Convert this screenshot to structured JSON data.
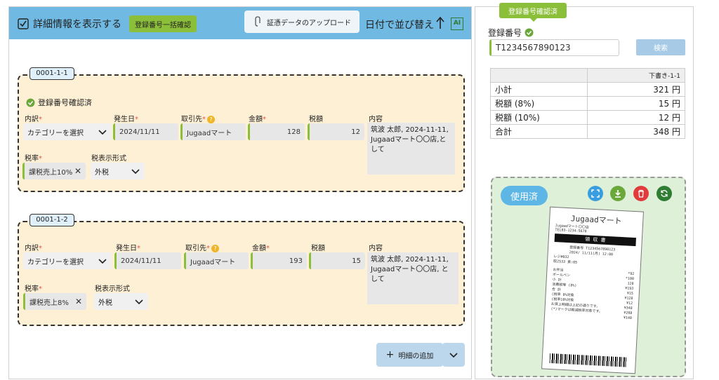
{
  "topbar": {
    "show_details": "詳細情報を表示する",
    "bulk_check": "登録番号一括確認",
    "upload": "証憑データのアップロード",
    "sort": "日付で並び替え"
  },
  "entries": [
    {
      "id": "0001-1-1",
      "status": "登録番号確認済",
      "category_label": "内訳",
      "category": "カテゴリーを選択",
      "date_label": "発生日",
      "date": "2024/11/11",
      "partner_label": "取引先",
      "partner": "Jugaadマート",
      "amount_label": "金額",
      "amount": "128",
      "tax_label": "税額",
      "tax": "12",
      "content_label": "内容",
      "content": "筑波 太郎, 2024-11-11, Jugaadマート〇〇店,として",
      "rate_label": "税率",
      "rate": "課税売上10%",
      "tax_display_label": "税表示形式",
      "tax_display": "外税"
    },
    {
      "id": "0001-1-2",
      "category_label": "内訳",
      "category": "カテゴリーを選択",
      "date_label": "発生日",
      "date": "2024/11/11",
      "partner_label": "取引先",
      "partner": "Jugaadマート",
      "amount_label": "金額",
      "amount": "193",
      "tax_label": "税額",
      "tax": "15",
      "content_label": "内容",
      "content": "筑波 太郎, 2024-11-11, Jugaadマート〇〇店, として",
      "rate_label": "税率",
      "rate": "課税売上8%",
      "tax_display_label": "税表示形式",
      "tax_display": "外税"
    }
  ],
  "add_detail": "明細の追加",
  "right": {
    "badge": "登録番号確認済",
    "reg_label": "登録番号",
    "reg_value": "T1234567890123",
    "search": "検索",
    "summary_header": "下書き-1-1",
    "rows": [
      {
        "label": "小計",
        "value": "321 円"
      },
      {
        "label": "税額 (8%)",
        "value": "15 円"
      },
      {
        "label": "税額 (10%)",
        "value": "12 円"
      },
      {
        "label": "合計",
        "value": "348 円"
      }
    ],
    "used": "使用済"
  },
  "receipt": {
    "store": "Jugaadマート",
    "branch": "Jugaadマート〇〇店",
    "tel": "TEL03-1234-5678",
    "title": "領 収 書",
    "reg": "登録番号 T1234567890123",
    "datetime": "2024/ 11/11(月) 12:00",
    "register": "レジ#032",
    "count": "取2533 責:05",
    "lines": [
      "お弁当",
      "ボールペン",
      "小 計",
      "消費税等 (8%)",
      "合 計",
      "(税率 8%対象",
      "(税率10%対象",
      "お買上明細は上記の通りです。",
      "(*)マークは軽減税率対象です。"
    ],
    "values": [
      "*92",
      "*100",
      "128",
      "¥193",
      "¥15",
      "¥128",
      "¥12",
      "¥348",
      "¥208",
      "¥140"
    ]
  },
  "colors": {
    "topbar": "#6fb9e3",
    "accent_green": "#8bbf3a",
    "card_bg": "#fdf0d5",
    "receipt_area": "#dff0d8"
  }
}
